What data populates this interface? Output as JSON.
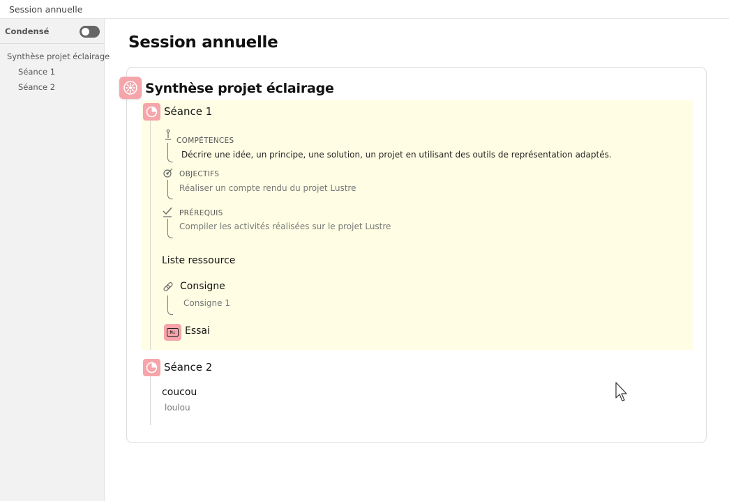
{
  "window": {
    "title": "Session annuelle"
  },
  "sidebar": {
    "condense_label": "Condensé",
    "items": [
      {
        "label": "Synthèse projet éclairage"
      },
      {
        "label": "Séance 1"
      },
      {
        "label": "Séance 2"
      }
    ]
  },
  "main": {
    "title": "Session annuelle",
    "project": {
      "title": "Synthèse projet éclairage",
      "seances": [
        {
          "title": "Séance 1",
          "competences": {
            "label": "COMPÉTENCES",
            "text": "Décrire une idée, un principe, une solution, un projet en utilisant des outils de représentation adaptés."
          },
          "objectifs": {
            "label": "OBJECTIFS",
            "text": "Réaliser un compte rendu du projet Lustre"
          },
          "prerequis": {
            "label": "PRÉREQUIS",
            "text": "Compiler les activités réalisées sur le projet Lustre"
          },
          "resources": {
            "title": "Liste ressource",
            "consigne": {
              "title": "Consigne",
              "sub": "Consigne 1"
            },
            "essai": {
              "title": "Essai",
              "icon": "M↓"
            }
          }
        },
        {
          "title": "Séance 2",
          "item": {
            "title": "coucou",
            "sub": "loulou"
          }
        }
      ]
    }
  },
  "colors": {
    "accent_pink": "#f6a5aa",
    "highlight_yellow": "#fffee4"
  }
}
